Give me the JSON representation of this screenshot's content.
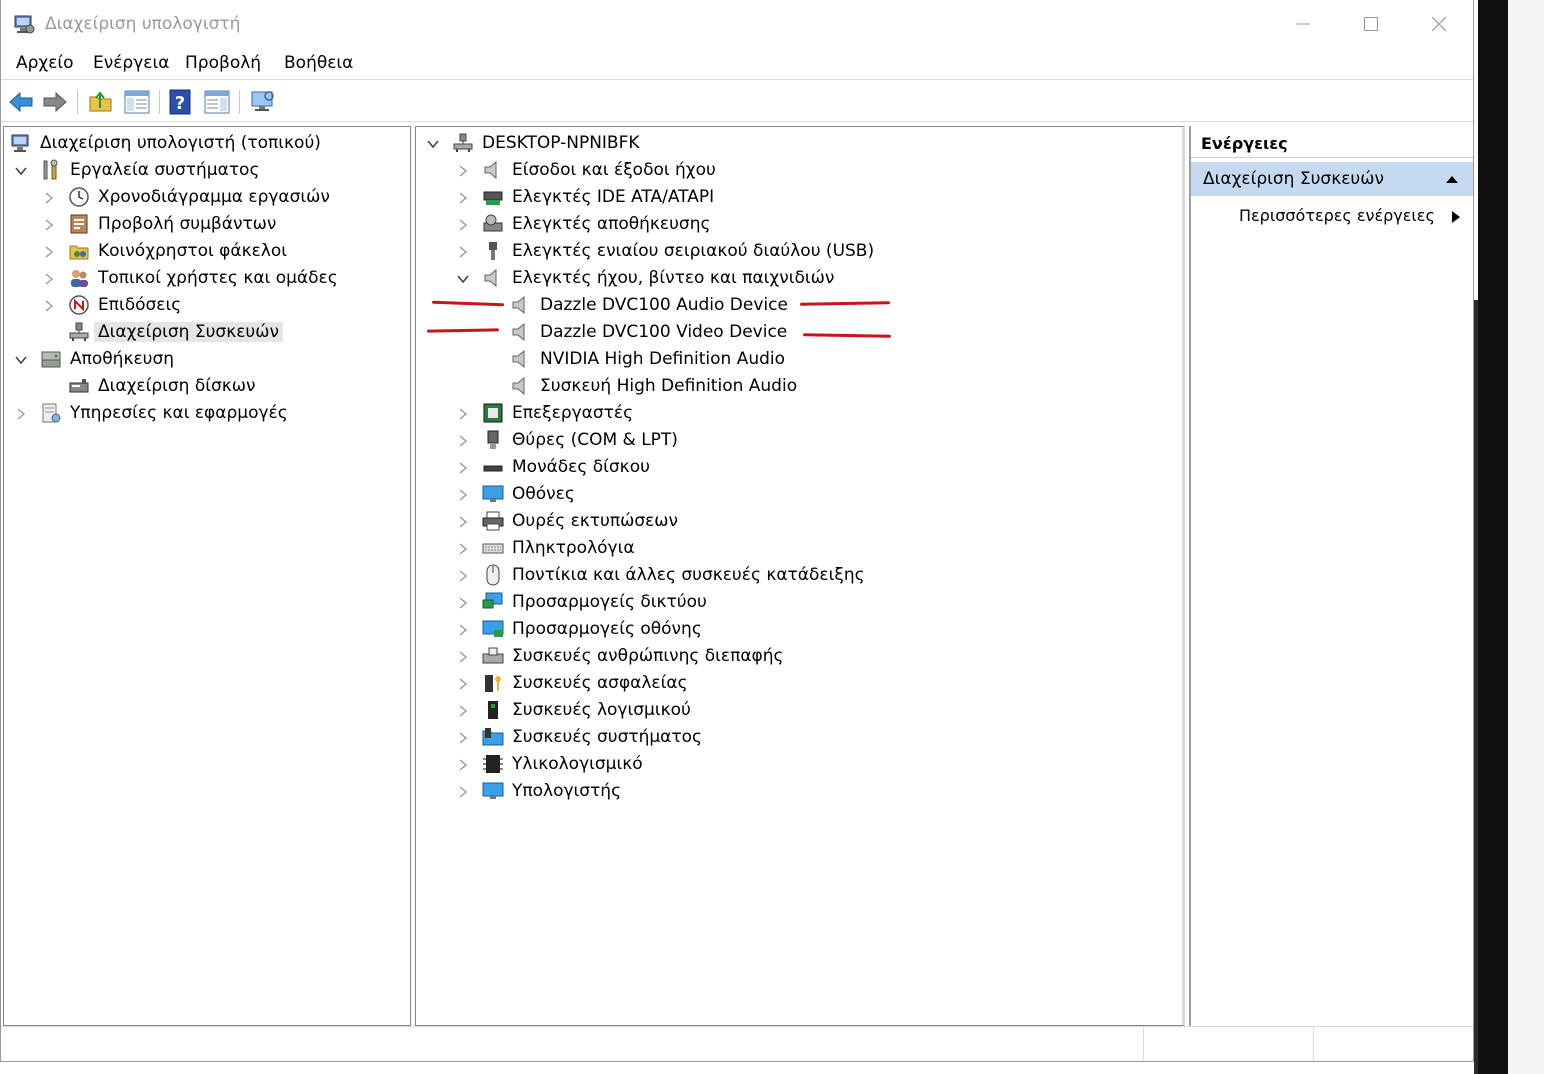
{
  "window": {
    "title": "Διαχείριση υπολογιστή"
  },
  "menu": [
    "Αρχείο",
    "Ενέργεια",
    "Προβολή",
    "Βοήθεια"
  ],
  "tree": {
    "root": "Διαχείριση υπολογιστή (τοπικού)",
    "system_tools": "Εργαλεία συστήματος",
    "task_scheduler": "Χρονοδιάγραμμα εργασιών",
    "event_viewer": "Προβολή συμβάντων",
    "shared_folders": "Κοινόχρηστοι φάκελοι",
    "local_users": "Τοπικοί χρήστες και ομάδες",
    "performance": "Επιδόσεις",
    "device_manager": "Διαχείριση Συσκευών",
    "storage": "Αποθήκευση",
    "disk_management": "Διαχείριση δίσκων",
    "services": "Υπηρεσίες και εφαρμογές"
  },
  "devices": {
    "computer": "DESKTOP-NPNIBFK",
    "audio_io": "Είσοδοι και έξοδοι ήχου",
    "ide": "Ελεγκτές IDE ATA/ATAPI",
    "storage_ctrl": "Ελεγκτές αποθήκευσης",
    "usb": "Ελεγκτές ενιαίου σειριακού διαύλου (USB)",
    "sound": "Ελεγκτές ήχου, βίντεο και παιχνιδιών",
    "sound_children": [
      "Dazzle DVC100 Audio Device",
      "Dazzle DVC100 Video Device",
      "NVIDIA High Definition Audio",
      "Συσκευή High Definition Audio"
    ],
    "processors": "Επεξεργαστές",
    "ports": "Θύρες (COM & LPT)",
    "disk_drives": "Μονάδες δίσκου",
    "monitors": "Οθόνες",
    "print_queues": "Ουρές εκτυπώσεων",
    "keyboards": "Πληκτρολόγια",
    "mice": "Ποντίκια και άλλες συσκευές κατάδειξης",
    "network": "Προσαρμογείς δικτύου",
    "display": "Προσαρμογείς οθόνης",
    "hid": "Συσκευές ανθρώπινης διεπαφής",
    "security": "Συσκευές ασφαλείας",
    "software": "Συσκευές λογισμικού",
    "system": "Συσκευές συστήματος",
    "firmware": "Υλικολογισμικό",
    "computers": "Υπολογιστής"
  },
  "actions": {
    "header": "Ενέργειες",
    "section": "Διαχείριση Συσκευών",
    "more": "Περισσότερες ενέργειες"
  },
  "colors": {
    "selection": "#c5d9f0",
    "annotation": "#c8151b"
  }
}
